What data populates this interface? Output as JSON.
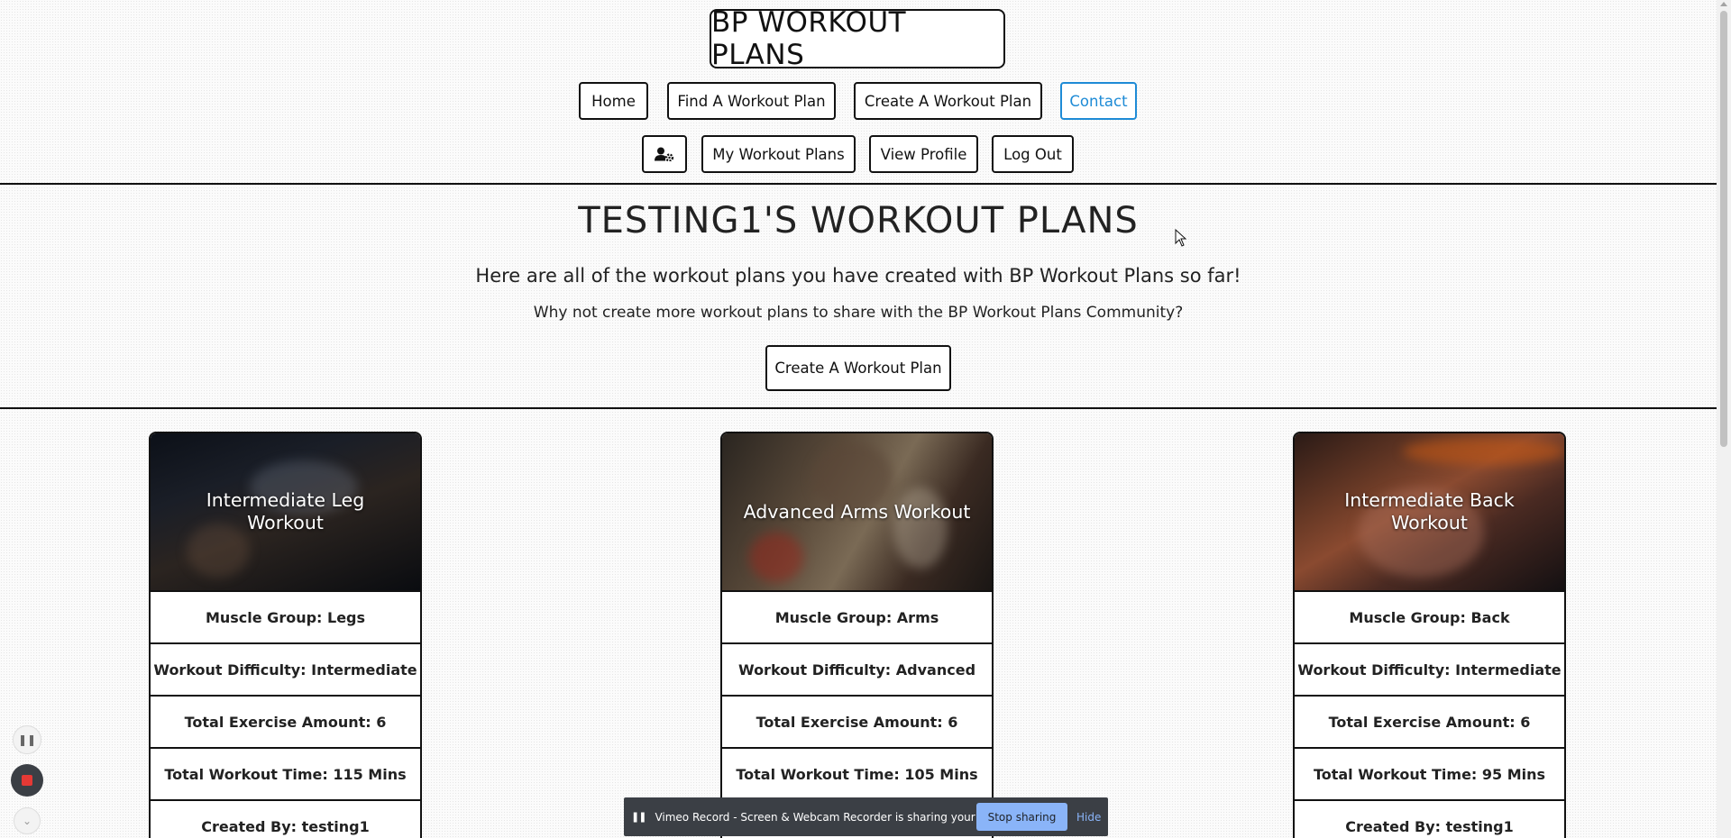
{
  "brand": "BP WORKOUT PLANS",
  "nav": {
    "home": "Home",
    "find": "Find A Workout Plan",
    "create": "Create A Workout Plan",
    "contact": "Contact",
    "my_plans": "My Workout Plans",
    "profile": "View Profile",
    "logout": "Log Out",
    "user_icon": "user-cog-icon"
  },
  "colors": {
    "contact_accent": "#1e8bd6",
    "stop_sharing": "#8ab4f8"
  },
  "main": {
    "heading": "TESTING1'S WORKOUT PLANS",
    "subtitle": "Here are all of the workout plans you have created with BP Workout Plans so far!",
    "prompt": "Why not create more workout plans to share with the BP Workout Plans Community?",
    "cta": "Create A Workout Plan"
  },
  "cards": [
    {
      "title": "Intermediate Leg Workout",
      "muscle": "Muscle Group: Legs",
      "difficulty": "Workout Difficulty: Intermediate",
      "exercises": "Total Exercise Amount: 6",
      "time": "Total Workout Time: 115 Mins",
      "creator": "Created By: testing1"
    },
    {
      "title": "Advanced Arms Workout",
      "muscle": "Muscle Group: Arms",
      "difficulty": "Workout Difficulty: Advanced",
      "exercises": "Total Exercise Amount: 6",
      "time": "Total Workout Time: 105 Mins",
      "creator": ""
    },
    {
      "title": "Intermediate Back Workout",
      "muscle": "Muscle Group: Back",
      "difficulty": "Workout Difficulty: Intermediate",
      "exercises": "Total Exercise Amount: 6",
      "time": "Total Workout Time: 95 Mins",
      "creator": "Created By: testing1"
    }
  ],
  "recorder": {
    "message": "Vimeo Record - Screen & Webcam Recorder is sharing your screen.",
    "stop": "Stop sharing",
    "hide": "Hide"
  }
}
